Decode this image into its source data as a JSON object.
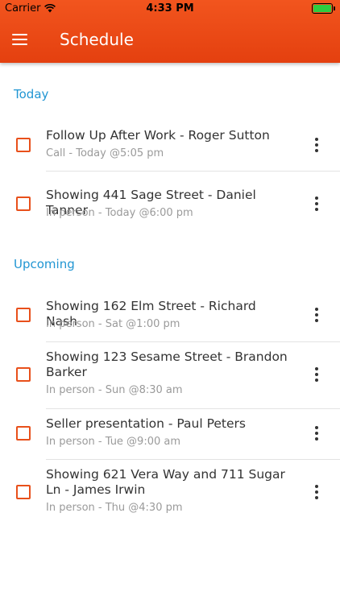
{
  "status_bar": {
    "carrier": "Carrier",
    "time": "4:33 PM"
  },
  "header": {
    "title": "Schedule"
  },
  "sections": [
    {
      "label": "Today",
      "items": [
        {
          "title": "Follow Up After Work - Roger Sutton",
          "subtitle": "Call - Today @5:05 pm"
        },
        {
          "title": "Showing 441 Sage Street - Daniel Tanner",
          "subtitle": "In person - Today @6:00 pm"
        }
      ]
    },
    {
      "label": "Upcoming",
      "items": [
        {
          "title": "Showing 162 Elm Street - Richard Nash",
          "subtitle": "In person - Sat @1:00 pm"
        },
        {
          "title": "Showing 123 Sesame Street - Brandon Barker",
          "subtitle": "In person - Sun @8:30 am"
        },
        {
          "title": "Seller presentation - Paul Peters",
          "subtitle": "In person - Tue @9:00 am"
        },
        {
          "title": "Showing 621 Vera Way and 711 Sugar Ln - James Irwin",
          "subtitle": "In person - Thu @4:30 pm"
        }
      ]
    }
  ],
  "colors": {
    "accent": "#e8501b",
    "section_label": "#2196d3",
    "header_bg": "#ec4b16"
  },
  "icons": {
    "menu": "hamburger-menu-icon",
    "row_action": "more-vertical-icon",
    "checkbox": "checkbox-unchecked-icon"
  }
}
